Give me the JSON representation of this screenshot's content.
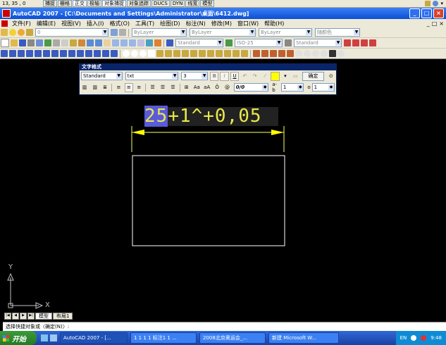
{
  "statusbar": {
    "coords": "13, 35 , 0",
    "toggles": [
      "捕捉",
      "栅格",
      "正交",
      "极轴",
      "对象捕捉",
      "对象追踪",
      "DUCS",
      "DYN",
      "线宽",
      "模型"
    ]
  },
  "titlebar": {
    "title": "AutoCAD 2007 - [C:\\Documents and Settings\\Administrator\\桌面\\6412.dwg]",
    "min": "_",
    "max": "□",
    "close": "×"
  },
  "menubar": {
    "items": [
      "文件(F)",
      "编辑(E)",
      "视图(V)",
      "插入(I)",
      "格式(O)",
      "工具(T)",
      "绘图(D)",
      "标注(N)",
      "修改(M)",
      "窗口(W)",
      "帮助(H)"
    ],
    "doc_min": "_",
    "doc_max": "□",
    "doc_close": "×"
  },
  "toolbar_layer": {
    "layer_value": "0",
    "color_value": "ByLayer",
    "linetype_value": "ByLayer",
    "lineweight_value": "ByLayer",
    "plotstyle_value": "随颜色"
  },
  "toolbar_styles": {
    "text_style": "Standard",
    "dim_style": "ISO-25",
    "table_style": "Standard"
  },
  "textformat": {
    "title": "文字格式",
    "style": "Standard",
    "font": "txt",
    "height": "3",
    "ok_label": "确定",
    "oblique_value": "0/0",
    "tracking_value": "1",
    "width_value": "1",
    "bold": "B",
    "italic": "I",
    "underline": "U",
    "overline": "Ō",
    "at": "@",
    "tracking_label": "a-b",
    "width_label": "o"
  },
  "drawing": {
    "text_selected": "25",
    "text_rest": "+1^+0,05"
  },
  "ucs": {
    "x_label": "X",
    "y_label": "Y"
  },
  "tabs": {
    "model": "模型",
    "layout": "布局1"
  },
  "cmdline": {
    "text": "选择快捷对象或〈确定(N)〉:"
  },
  "taskbar": {
    "start": "开始",
    "tasks": [
      "AutoCAD 2007 - [...",
      "1 1 1 1 标注1 1 ...",
      "2008北京奥运会_...",
      "新建 Microsoft W..."
    ],
    "lang": "EN",
    "time": "9:48"
  },
  "colors": {
    "canvas": "#000000",
    "dimension": "#ffff00",
    "geometry": "#ffffff",
    "title_gradient": "#0a4fd6"
  }
}
